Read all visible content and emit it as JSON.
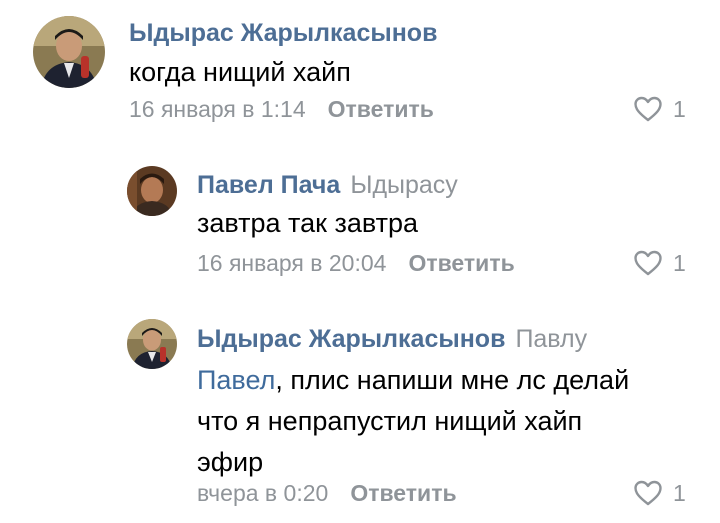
{
  "comments": [
    {
      "author": "Ыдырас Жарылкасынов",
      "reply_to": "",
      "text": "когда нищий хайп",
      "time": "16 января в 1:14",
      "reply_label": "Ответить",
      "likes": "1"
    },
    {
      "author": "Павел Пача",
      "reply_to": "Ыдырасу",
      "text": "завтра так завтра",
      "time": "16 января в 20:04",
      "reply_label": "Ответить",
      "likes": "1"
    },
    {
      "author": "Ыдырас Жарылкасынов",
      "reply_to": "Павлу",
      "mention": "Павел",
      "text_line1": ", плис напиши мне лс делай",
      "text_line2": "что я непрапустил нищий хайп",
      "text_line3": "эфир",
      "time": "вчера в 0:20",
      "reply_label": "Ответить",
      "likes": "1"
    }
  ],
  "icons": {
    "like": "heart-outline-icon"
  },
  "colors": {
    "author": "#4d6e95",
    "secondary": "#8f9499",
    "mention": "#3f6b9c",
    "text": "#000000"
  }
}
